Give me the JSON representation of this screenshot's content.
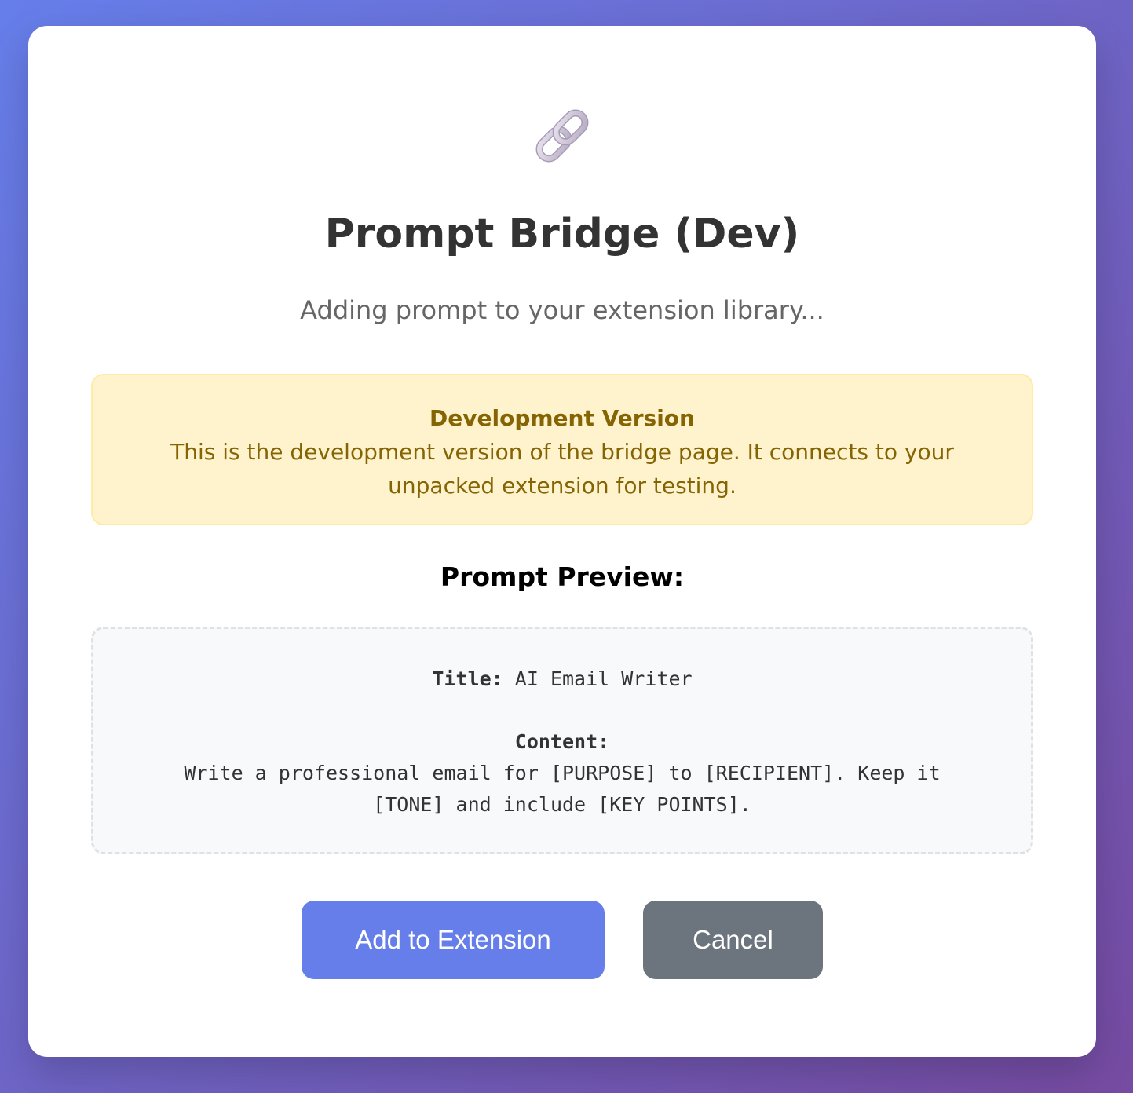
{
  "header": {
    "icon": "link-icon",
    "title": "Prompt Bridge (Dev)",
    "subtitle": "Adding prompt to your extension library..."
  },
  "warning": {
    "title": "Development Version",
    "text": "This is the development version of the bridge page. It connects to your unpacked extension for testing."
  },
  "preview": {
    "heading": "Prompt Preview:",
    "title_label": "Title:",
    "title_value": "AI Email Writer",
    "content_label": "Content:",
    "content_value": "Write a professional email for [PURPOSE] to [RECIPIENT]. Keep it [TONE] and include [KEY POINTS]."
  },
  "actions": {
    "add_label": "Add to Extension",
    "cancel_label": "Cancel"
  },
  "colors": {
    "background_start": "#667eea",
    "background_end": "#764ba2",
    "primary_button": "#667eea",
    "secondary_button": "#6c757d",
    "warning_bg": "#fff3cd",
    "warning_text": "#856404"
  }
}
